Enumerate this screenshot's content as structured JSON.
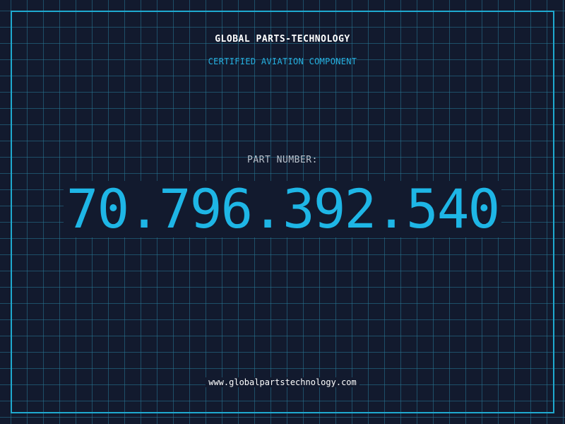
{
  "header": {
    "company_name": "GLOBAL PARTS-TECHNOLOGY",
    "subtitle": "CERTIFIED AVIATION COMPONENT"
  },
  "part": {
    "label": "PART NUMBER:",
    "number": "70.796.392.540"
  },
  "footer": {
    "website": "www.globalpartstechnology.com"
  },
  "colors": {
    "background": "#121a2e",
    "grid": "#28789b",
    "accent": "#1eb6e6",
    "frame": "#1fa9cf",
    "text": "#ffffff"
  }
}
